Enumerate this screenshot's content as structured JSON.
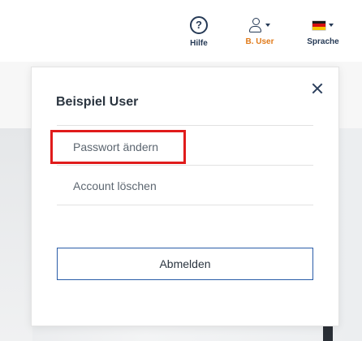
{
  "nav": {
    "help_label": "Hilfe",
    "help_glyph": "?",
    "user_label": "B. User",
    "language_label": "Sprache"
  },
  "user_menu": {
    "title": "Beispiel User",
    "items": [
      {
        "label": "Passwort ändern"
      },
      {
        "label": "Account löschen"
      }
    ],
    "logout_label": "Abmelden"
  },
  "colors": {
    "accent_orange": "#e07a1a",
    "navy": "#263a56",
    "highlight_red": "#e01b1b",
    "button_border": "#2a5da8"
  },
  "icons": {
    "help": "help-circle-icon",
    "user": "user-icon",
    "flag": "flag-germany-icon",
    "close": "close-icon"
  }
}
